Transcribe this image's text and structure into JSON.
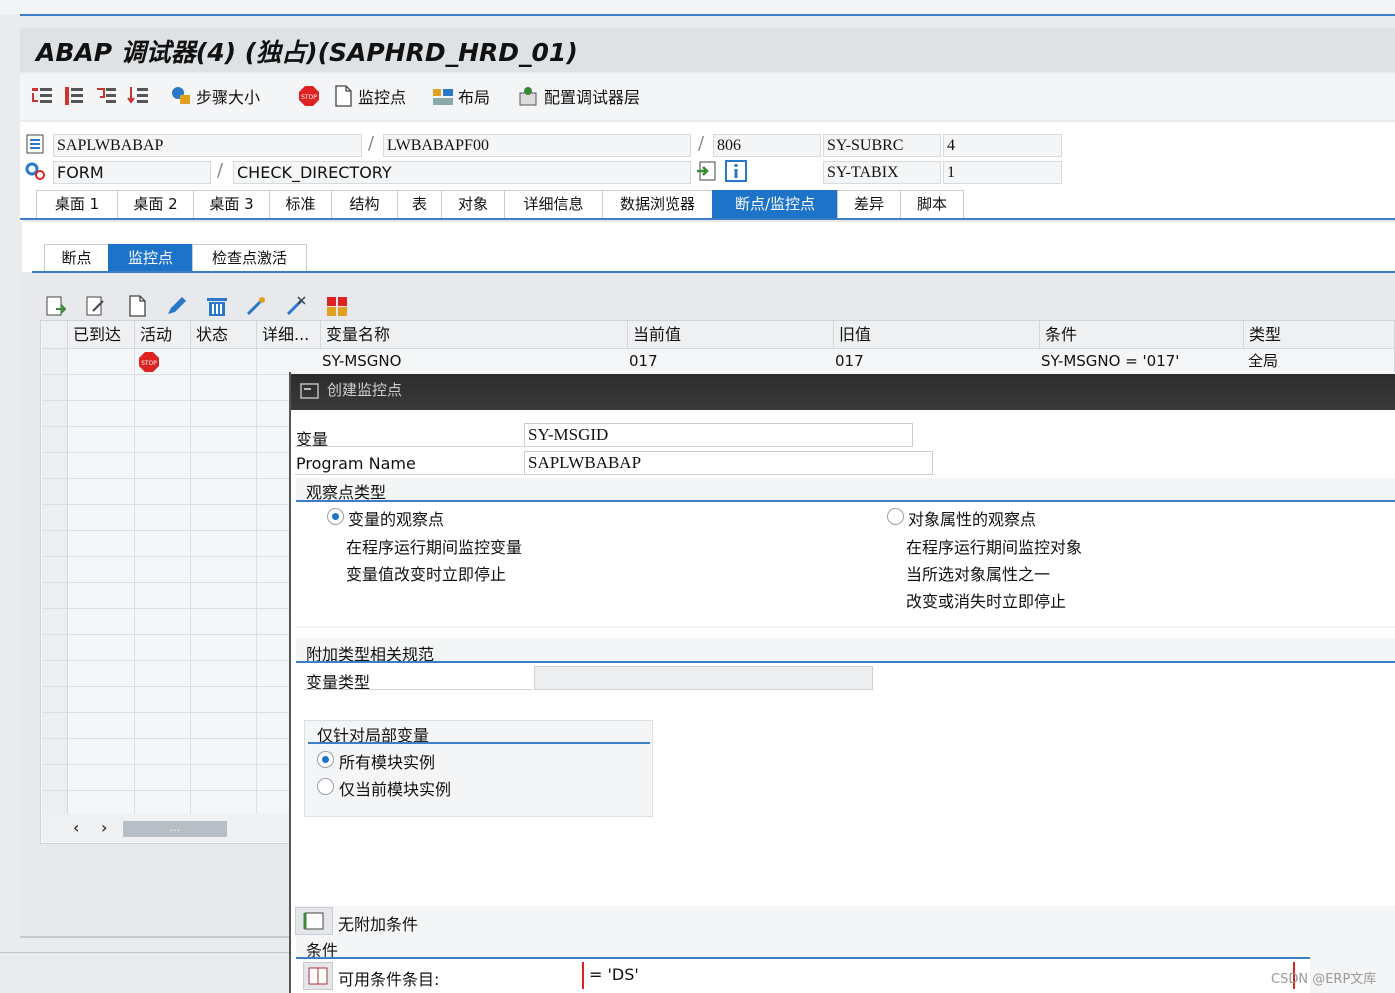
{
  "window": {
    "title": "ABAP 调试器(4)  (独占)(SAPHRD_HRD_01)"
  },
  "toolbar": {
    "step_size": "步骤大小",
    "watchpoint": "监控点",
    "layout": "布局",
    "config_layers": "配置调试器层"
  },
  "header": {
    "program": "SAPLWBABAP",
    "include": "LWBABAPF00",
    "line": "806",
    "sy_subrc_label": "SY-SUBRC",
    "sy_subrc_value": "4",
    "event_type": "FORM",
    "event_name": "CHECK_DIRECTORY",
    "sy_tabix_label": "SY-TABIX",
    "sy_tabix_value": "1"
  },
  "tabs": [
    "桌面 1",
    "桌面 2",
    "桌面 3",
    "标准",
    "结构",
    "表",
    "对象",
    "详细信息",
    "数据浏览器",
    "断点/监控点",
    "差异",
    "脚本"
  ],
  "subtabs": [
    "断点",
    "监控点",
    "检查点激活"
  ],
  "grid": {
    "headers": [
      "已到达",
      "活动",
      "状态",
      "详细...",
      "变量名称",
      "当前值",
      "旧值",
      "条件",
      "类型"
    ],
    "rows": [
      {
        "variable": "SY-MSGNO",
        "current": "017",
        "old": "017",
        "condition": "SY-MSGNO = '017'",
        "type": "全局"
      }
    ],
    "scroll_thumb": "..."
  },
  "dialog": {
    "title": "创建监控点",
    "variable_label": "变量",
    "variable_value": "SY-MSGID",
    "program_label": "Program Name",
    "program_value": "SAPLWBABAP",
    "watch_type_heading": "观察点类型",
    "option_variable": "变量的观察点",
    "option_variable_desc1": "在程序运行期间监控变量",
    "option_variable_desc2": "变量值改变时立即停止",
    "option_object": "对象属性的观察点",
    "option_object_desc1": "在程序运行期间监控对象",
    "option_object_desc2": "当所选对象属性之一",
    "option_object_desc3": "改变或消失时立即停止",
    "additional_heading": "附加类型相关规范",
    "var_type_label": "变量类型",
    "local_heading": "仅针对局部变量",
    "all_instances": "所有模块实例",
    "current_instance": "仅当前模块实例",
    "no_condition": "无附加条件",
    "condition_heading": "条件",
    "available_items_label": "可用条件条目:",
    "condition_value": "= 'DS'"
  },
  "watermark": "CSDN @ERP文库"
}
